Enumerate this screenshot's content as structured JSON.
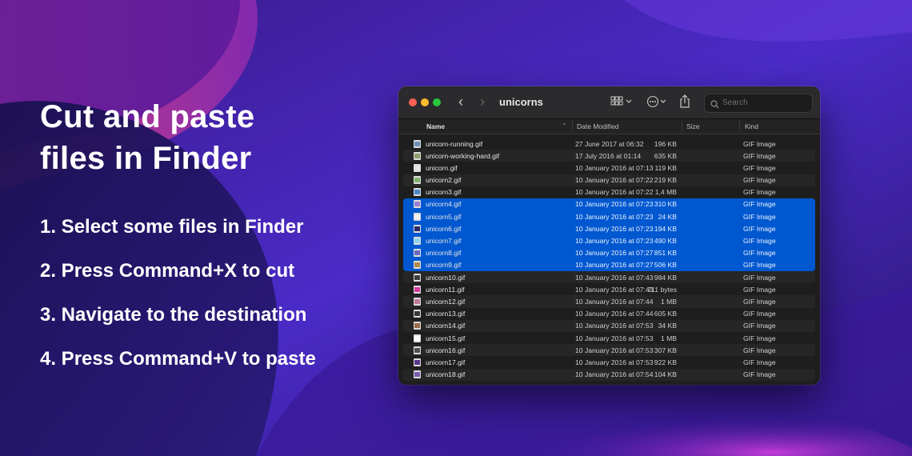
{
  "headline": {
    "line1": "Cut and paste",
    "line2": "files in Finder"
  },
  "steps": [
    "1. Select some files in Finder",
    "2. Press Command+X to cut",
    "3. Navigate to the destination",
    "4. Press Command+V to paste"
  ],
  "colors": {
    "selection": "#0058d0",
    "window_bg": "#1e1e1f",
    "traffic_red": "#ff5f57",
    "traffic_yellow": "#febc2e",
    "traffic_green": "#28c840"
  },
  "window": {
    "title": "unicorns",
    "search_placeholder": "Search",
    "toolbar_icons": [
      "back-chevron-icon",
      "forward-chevron-icon",
      "view-grid-icon",
      "more-actions-icon",
      "share-icon",
      "search-icon"
    ],
    "columns": {
      "name": "Name",
      "date": "Date Modified",
      "size": "Size",
      "kind": "Kind"
    },
    "files": [
      {
        "name": "unicorn-running.gif",
        "date": "27 June 2017 at 06:32",
        "size": "196 KB",
        "kind": "GIF Image",
        "selected": false,
        "thumb": "#6d8fb3"
      },
      {
        "name": "unicorn-working-hard.gif",
        "date": "17 July 2016 at 01:14",
        "size": "635 KB",
        "kind": "GIF Image",
        "selected": false,
        "thumb": "#8a9d6a"
      },
      {
        "name": "unicorn.gif",
        "date": "10 January 2016 at 07:13",
        "size": "119 KB",
        "kind": "GIF Image",
        "selected": false,
        "thumb": "#e6e6e6"
      },
      {
        "name": "unicorn2.gif",
        "date": "10 January 2016 at 07:22",
        "size": "219 KB",
        "kind": "GIF Image",
        "selected": false,
        "thumb": "#7fb06a"
      },
      {
        "name": "unicorn3.gif",
        "date": "10 January 2016 at 07:22",
        "size": "1,4 MB",
        "kind": "GIF Image",
        "selected": false,
        "thumb": "#4b86c6"
      },
      {
        "name": "unicorn4.gif",
        "date": "10 January 2016 at 07:23",
        "size": "310 KB",
        "kind": "GIF Image",
        "selected": true,
        "thumb": "#9a7fd6"
      },
      {
        "name": "unicorn5.gif",
        "date": "10 January 2016 at 07:23",
        "size": "24 KB",
        "kind": "GIF Image",
        "selected": true,
        "thumb": "#f2f2f2"
      },
      {
        "name": "unicorn6.gif",
        "date": "10 January 2016 at 07:23",
        "size": "194 KB",
        "kind": "GIF Image",
        "selected": true,
        "thumb": "#2a2a6a"
      },
      {
        "name": "unicorn7.gif",
        "date": "10 January 2016 at 07:23",
        "size": "490 KB",
        "kind": "GIF Image",
        "selected": true,
        "thumb": "#8fd3f0"
      },
      {
        "name": "unicorn8.gif",
        "date": "10 January 2016 at 07:27",
        "size": "851 KB",
        "kind": "GIF Image",
        "selected": true,
        "thumb": "#6a6ac0"
      },
      {
        "name": "unicorn9.gif",
        "date": "10 January 2016 at 07:27",
        "size": "506 KB",
        "kind": "GIF Image",
        "selected": true,
        "thumb": "#b0884a"
      },
      {
        "name": "unicorn10.gif",
        "date": "10 January 2016 at 07:43",
        "size": "984 KB",
        "kind": "GIF Image",
        "selected": false,
        "thumb": "#404040"
      },
      {
        "name": "unicorn11.gif",
        "date": "10 January 2016 at 07:43",
        "size": "711 bytes",
        "kind": "GIF Image",
        "selected": false,
        "thumb": "#d23aa0"
      },
      {
        "name": "unicorn12.gif",
        "date": "10 January 2016 at 07:44",
        "size": "1 MB",
        "kind": "GIF Image",
        "selected": false,
        "thumb": "#c07a9a"
      },
      {
        "name": "unicorn13.gif",
        "date": "10 January 2016 at 07:44",
        "size": "605 KB",
        "kind": "GIF Image",
        "selected": false,
        "thumb": "#3a3a3a"
      },
      {
        "name": "unicorn14.gif",
        "date": "10 January 2016 at 07:53",
        "size": "34 KB",
        "kind": "GIF Image",
        "selected": false,
        "thumb": "#9a6a4a"
      },
      {
        "name": "unicorn15.gif",
        "date": "10 January 2016 at 07:53",
        "size": "1 MB",
        "kind": "GIF Image",
        "selected": false,
        "thumb": "#ffffff"
      },
      {
        "name": "unicorn16.gif",
        "date": "10 January 2016 at 07:53",
        "size": "307 KB",
        "kind": "GIF Image",
        "selected": false,
        "thumb": "#505050"
      },
      {
        "name": "unicorn17.gif",
        "date": "10 January 2016 at 07:53",
        "size": "922 KB",
        "kind": "GIF Image",
        "selected": false,
        "thumb": "#5a3a8a"
      },
      {
        "name": "unicorn18.gif",
        "date": "10 January 2016 at 07:54",
        "size": "104 KB",
        "kind": "GIF Image",
        "selected": false,
        "thumb": "#7a5ab0"
      }
    ]
  }
}
